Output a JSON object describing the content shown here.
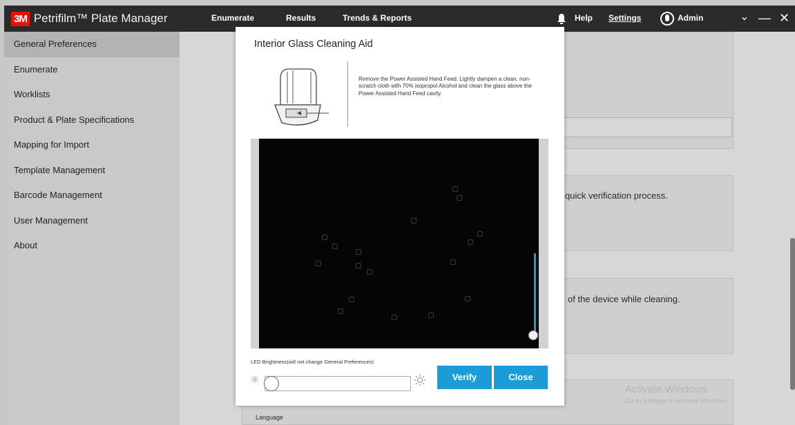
{
  "app": {
    "brand": "3M",
    "title": "Petrifilm™ Plate Manager"
  },
  "nav": {
    "items": [
      "Enumerate",
      "Results",
      "Trends & Reports"
    ]
  },
  "header_right": {
    "help": "Help",
    "settings": "Settings",
    "user": "Admin"
  },
  "window_controls": {
    "dropdown": "⌄",
    "minimize": "—",
    "close": "✕"
  },
  "sidebar": {
    "items": [
      {
        "label": "General Preferences",
        "active": true
      },
      {
        "label": "Enumerate"
      },
      {
        "label": "Worklists"
      },
      {
        "label": "Product & Plate Specifications"
      },
      {
        "label": "Mapping for Import"
      },
      {
        "label": "Template Management"
      },
      {
        "label": "Barcode Management"
      },
      {
        "label": "User Management"
      },
      {
        "label": "About"
      }
    ]
  },
  "background": {
    "text_verify": "quick verification process.",
    "text_cleaning": "of the device while cleaning.",
    "language_label": "Language",
    "watermark_title": "Activate Windows",
    "watermark_sub": "Go to Settings to activate Windows."
  },
  "modal": {
    "title": "Interior Glass Cleaning Aid",
    "instructions": "Remove the Power Assisted Hand Feed. Lightly dampen a clean, non-scratch cloth with 70% isopropol Alcohol and clean the glass above the Power Assisted Hand Feed cavity.",
    "led_label": "LED Brightness(will not change General Preferences)",
    "verify_label": "Verify",
    "close_label": "Close",
    "led_brightness": 0,
    "vertical_slider_level": 1
  },
  "colors": {
    "accent": "#1b9cd6",
    "topbar": "#2b2b2b",
    "brand_red": "#e3120b"
  }
}
